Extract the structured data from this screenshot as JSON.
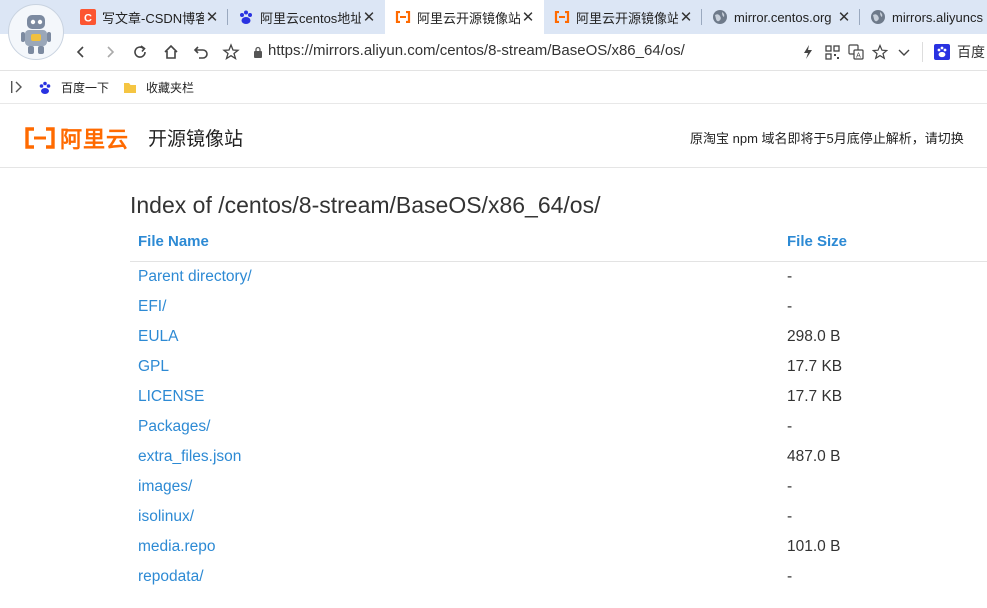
{
  "tabs": [
    {
      "title": "写文章-CSDN博客",
      "fav": "csdn-icon"
    },
    {
      "title": "阿里云centos地址",
      "fav": "baidu-paw-icon"
    },
    {
      "title": "阿里云开源镜像站",
      "fav": "aliyun-logo-icon",
      "active": true
    },
    {
      "title": "阿里云开源镜像站",
      "fav": "aliyun-logo-icon"
    },
    {
      "title": "mirror.centos.org",
      "fav": "globe-icon"
    },
    {
      "title": "mirrors.aliyuncs",
      "fav": "globe-icon"
    }
  ],
  "address": {
    "url": "https://mirrors.aliyun.com/centos/8-stream/BaseOS/x86_64/os/",
    "search_label": "百度"
  },
  "bookmarks": {
    "item1": "百度一下",
    "item2": "收藏夹栏"
  },
  "site": {
    "logo_text": "阿里云",
    "title": "开源镜像站",
    "notice": "原淘宝 npm 域名即将于5月底停止解析，请切换"
  },
  "listing": {
    "heading": "Index of /centos/8-stream/BaseOS/x86_64/os/",
    "col_name": "File Name",
    "col_size": "File Size",
    "rows": [
      {
        "name": "Parent directory/",
        "size": "-"
      },
      {
        "name": "EFI/",
        "size": "-"
      },
      {
        "name": "EULA",
        "size": "298.0 B"
      },
      {
        "name": "GPL",
        "size": "17.7 KB"
      },
      {
        "name": "LICENSE",
        "size": "17.7 KB"
      },
      {
        "name": "Packages/",
        "size": "-"
      },
      {
        "name": "extra_files.json",
        "size": "487.0 B"
      },
      {
        "name": "images/",
        "size": "-"
      },
      {
        "name": "isolinux/",
        "size": "-"
      },
      {
        "name": "media.repo",
        "size": "101.0 B"
      },
      {
        "name": "repodata/",
        "size": "-"
      }
    ]
  },
  "colors": {
    "link": "#2d8ad4",
    "brand": "#ff6a00",
    "tabstrip": "#dce6f5"
  }
}
